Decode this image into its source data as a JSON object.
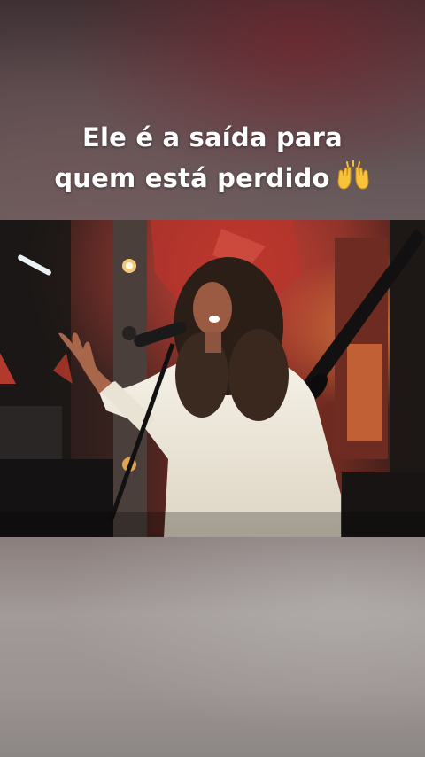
{
  "caption": {
    "line1": "Ele é a saída para",
    "line2": "quem está perdido",
    "emoji_icon": "raising-hands-emoji-icon"
  },
  "video": {
    "scene": "singer-performing-video-frame"
  },
  "colors": {
    "caption_text": "#ffffff",
    "stage_red": "#b3322b",
    "shirt": "#efe9dc"
  }
}
